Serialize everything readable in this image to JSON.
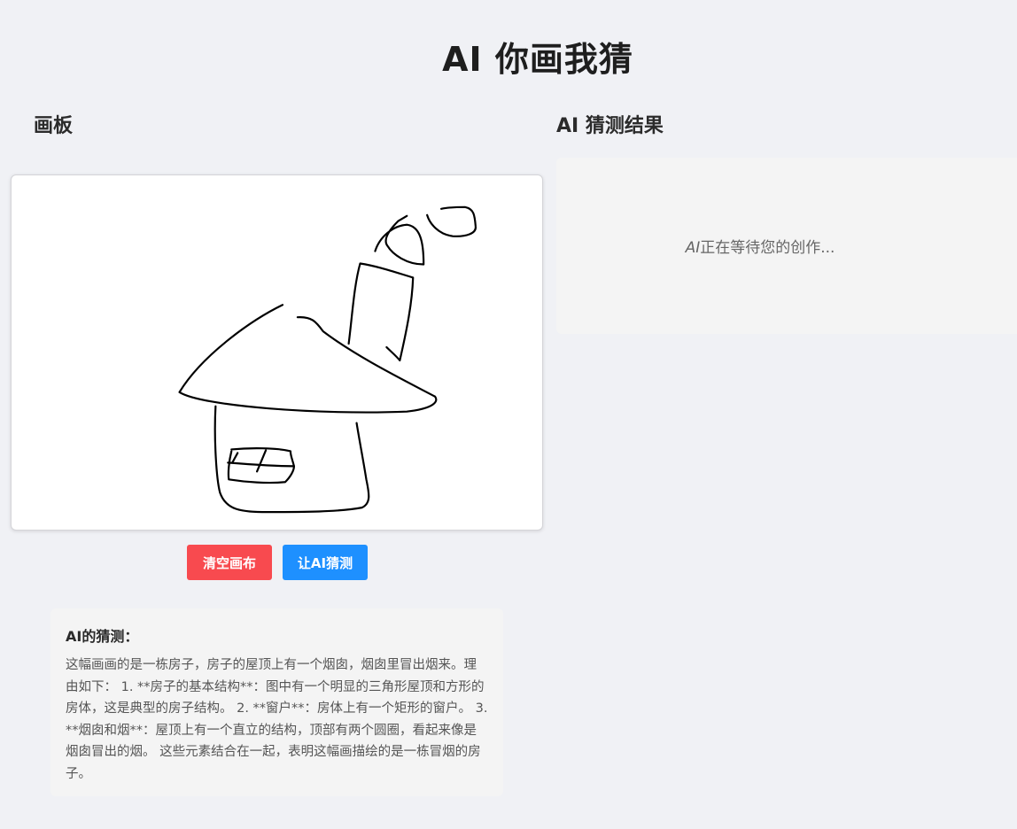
{
  "app": {
    "title": "AI 你画我猜"
  },
  "left": {
    "heading": "画板"
  },
  "right": {
    "heading": "AI 猜测结果",
    "waiting_prefix": "AI",
    "waiting_rest": "正在等待您的创作..."
  },
  "buttons": {
    "clear_label": "清空画布",
    "guess_label": "让AI猜测"
  },
  "result": {
    "title": "AI的猜测：",
    "text": "这幅画画的是一栋房子，房子的屋顶上有一个烟囱，烟囱里冒出烟来。理由如下： 1. **房子的基本结构**：图中有一个明显的三角形屋顶和方形的房体，这是典型的房子结构。 2. **窗户**：房体上有一个矩形的窗户。 3. **烟囱和烟**：屋顶上有一个直立的结构，顶部有两个圆圈，看起来像是烟囱冒出的烟。 这些元素结合在一起，表明这幅画描绘的是一栋冒烟的房子。"
  },
  "colors": {
    "clear_button": "#f84a4f",
    "guess_button": "#1e90ff",
    "background": "#f0f1f5",
    "stroke": "#000000"
  }
}
